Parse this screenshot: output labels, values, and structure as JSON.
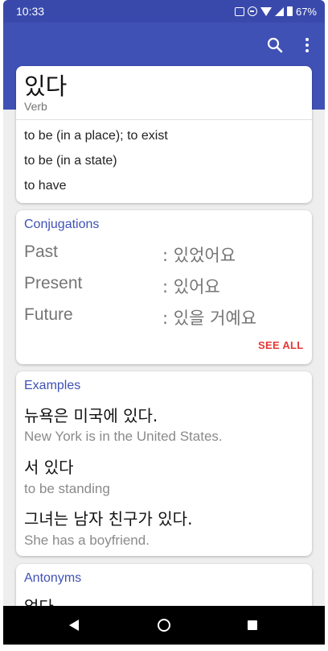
{
  "status_bar": {
    "time": "10:33",
    "battery": "67%",
    "icons": [
      "vibrate-icon",
      "do-not-disturb-icon",
      "wifi-icon",
      "cellular-signal-icon",
      "battery-icon"
    ]
  },
  "app_bar": {
    "actions": [
      "search-icon",
      "more-vert-icon"
    ]
  },
  "word_card": {
    "word": "있다",
    "part_of_speech": "Verb",
    "definitions": [
      "to be (in a place); to exist",
      "to be (in a state)",
      "to have"
    ]
  },
  "conjugations": {
    "title": "Conjugations",
    "rows": [
      {
        "label": "Past",
        "value": ": 있었어요"
      },
      {
        "label": "Present",
        "value": ": 있어요"
      },
      {
        "label": "Future",
        "value": ": 있을 거예요"
      }
    ],
    "see_all": "SEE ALL"
  },
  "examples": {
    "title": "Examples",
    "items": [
      {
        "korean": "뉴욕은 미국에 있다.",
        "english": "New York is in the United States."
      },
      {
        "korean": "서 있다",
        "english": "to be standing"
      },
      {
        "korean": "그녀는 남자 친구가 있다.",
        "english": "She has a boyfriend."
      }
    ]
  },
  "antonyms": {
    "title": "Antonyms",
    "first_item": "없다"
  },
  "nav_bar": {
    "buttons": [
      "back-icon",
      "home-icon",
      "recents-icon"
    ]
  },
  "colors": {
    "primary": "#3f51b5",
    "status_bar": "#3949ab",
    "accent": "#e53935",
    "background": "#eeeeee"
  }
}
